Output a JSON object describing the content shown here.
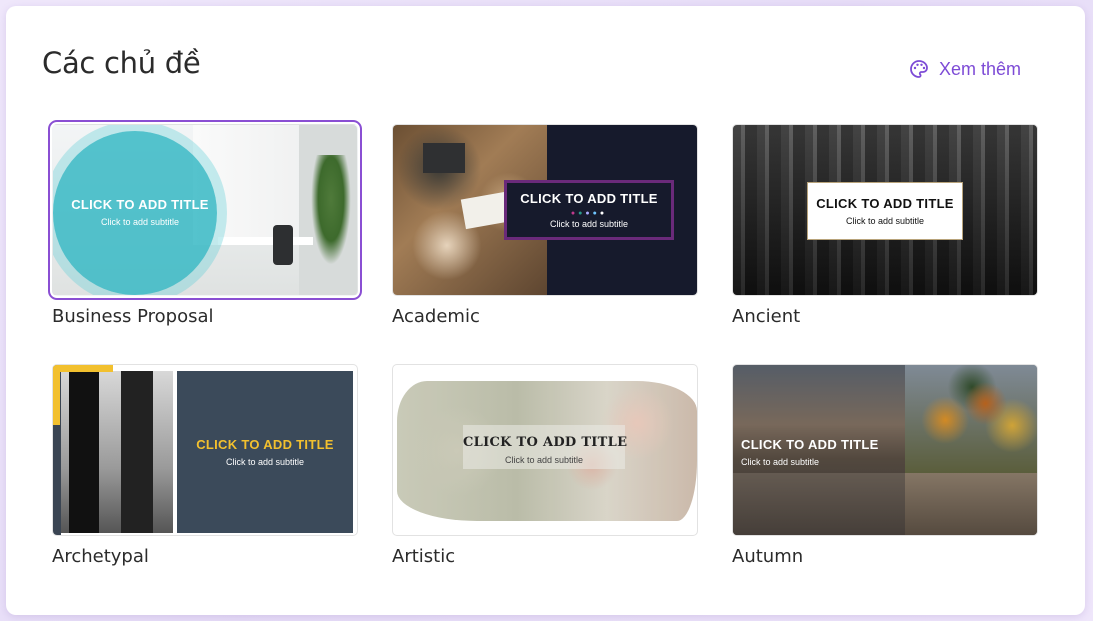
{
  "header": {
    "title": "Các chủ đề",
    "more_label": "Xem thêm"
  },
  "themes": [
    {
      "name": "Business Proposal",
      "selected": true,
      "preview_title": "CLICK TO ADD TITLE",
      "preview_subtitle": "Click to add subtitle"
    },
    {
      "name": "Academic",
      "selected": false,
      "preview_title": "CLICK TO ADD TITLE",
      "preview_subtitle": "Click to add subtitle"
    },
    {
      "name": "Ancient",
      "selected": false,
      "preview_title": "CLICK TO ADD TITLE",
      "preview_subtitle": "Click to add subtitle"
    },
    {
      "name": "Archetypal",
      "selected": false,
      "preview_title": "CLICK TO ADD TITLE",
      "preview_subtitle": "Click to add subtitle"
    },
    {
      "name": "Artistic",
      "selected": false,
      "preview_title": "CLICK TO ADD TITLE",
      "preview_subtitle": "Click to add subtitle"
    },
    {
      "name": "Autumn",
      "selected": false,
      "preview_title": "CLICK TO ADD TITLE",
      "preview_subtitle": "Click to add subtitle"
    }
  ],
  "colors": {
    "accent": "#7d4bd6",
    "selection_border": "#8a4fd3"
  },
  "icons": {
    "more": "palette-icon"
  }
}
